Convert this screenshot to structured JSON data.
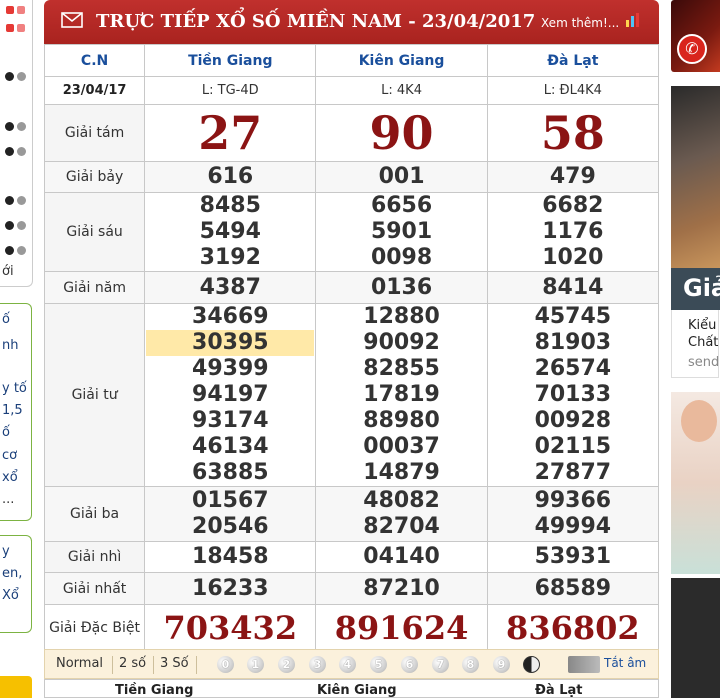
{
  "header": {
    "title": "TRỰC TIẾP XỔ SỐ MIỀN NAM - 23/04/2017",
    "more_link": "Xem thêm!..."
  },
  "table": {
    "corner_label": "C.N",
    "date": "23/04/17",
    "provinces": [
      {
        "name": "Tiền Giang",
        "code": "L: TG-4D"
      },
      {
        "name": "Kiên Giang",
        "code": "L: 4K4"
      },
      {
        "name": "Đà Lạt",
        "code": "L: ĐL4K4"
      }
    ],
    "prizes": [
      {
        "label": "Giải tám",
        "values": [
          [
            "27"
          ],
          [
            "90"
          ],
          [
            "58"
          ]
        ]
      },
      {
        "label": "Giải bảy",
        "values": [
          [
            "616"
          ],
          [
            "001"
          ],
          [
            "479"
          ]
        ]
      },
      {
        "label": "Giải sáu",
        "values": [
          [
            "8485",
            "5494",
            "3192"
          ],
          [
            "6656",
            "5901",
            "0098"
          ],
          [
            "6682",
            "1176",
            "1020"
          ]
        ]
      },
      {
        "label": "Giải năm",
        "values": [
          [
            "4387"
          ],
          [
            "0136"
          ],
          [
            "8414"
          ]
        ]
      },
      {
        "label": "Giải tư",
        "values": [
          [
            "34669",
            "30395",
            "49399",
            "94197",
            "93174",
            "46134",
            "63885"
          ],
          [
            "12880",
            "90092",
            "82855",
            "17819",
            "88980",
            "00037",
            "14879"
          ],
          [
            "45745",
            "81903",
            "26574",
            "70133",
            "00928",
            "02115",
            "27877"
          ]
        ]
      },
      {
        "label": "Giải ba",
        "values": [
          [
            "01567",
            "20546"
          ],
          [
            "48082",
            "82704"
          ],
          [
            "99366",
            "49994"
          ]
        ]
      },
      {
        "label": "Giải nhì",
        "values": [
          [
            "18458"
          ],
          [
            "04140"
          ],
          [
            "53931"
          ]
        ]
      },
      {
        "label": "Giải nhất",
        "values": [
          [
            "16233"
          ],
          [
            "87210"
          ],
          [
            "68589"
          ]
        ]
      },
      {
        "label": "Giải Đặc Biệt",
        "values": [
          [
            "703432"
          ],
          [
            "891624"
          ],
          [
            "836802"
          ]
        ]
      }
    ],
    "highlighted_value": "30395"
  },
  "toolbar": {
    "normal": "Normal",
    "two_digits": "2 số",
    "three_digits": "3 Số",
    "digits": [
      "0",
      "1",
      "2",
      "3",
      "4",
      "5",
      "6",
      "7",
      "8",
      "9"
    ],
    "mute": "Tắt âm"
  },
  "next_table": {
    "provinces": [
      "Tiền Giang",
      "Kiên Giang",
      "Đà Lạt"
    ]
  },
  "left_strip": {
    "text1": "ới",
    "box2_lines": [
      "ố",
      "nh",
      "y tố",
      "1,5",
      "ố",
      "cơ",
      "xổ",
      "..."
    ],
    "box3_lines": [
      "y",
      "en,",
      "Xổ"
    ]
  },
  "right_ads": {
    "ad2_title": "Giả",
    "ad2_line1": "Kiểu",
    "ad2_line2": "Chất",
    "ad2_line3": "send"
  },
  "colors": {
    "header_red": "#b12a26",
    "prize_red": "#8b1414",
    "province_blue": "#1a4f9c",
    "highlight": "#ffe9a8"
  }
}
